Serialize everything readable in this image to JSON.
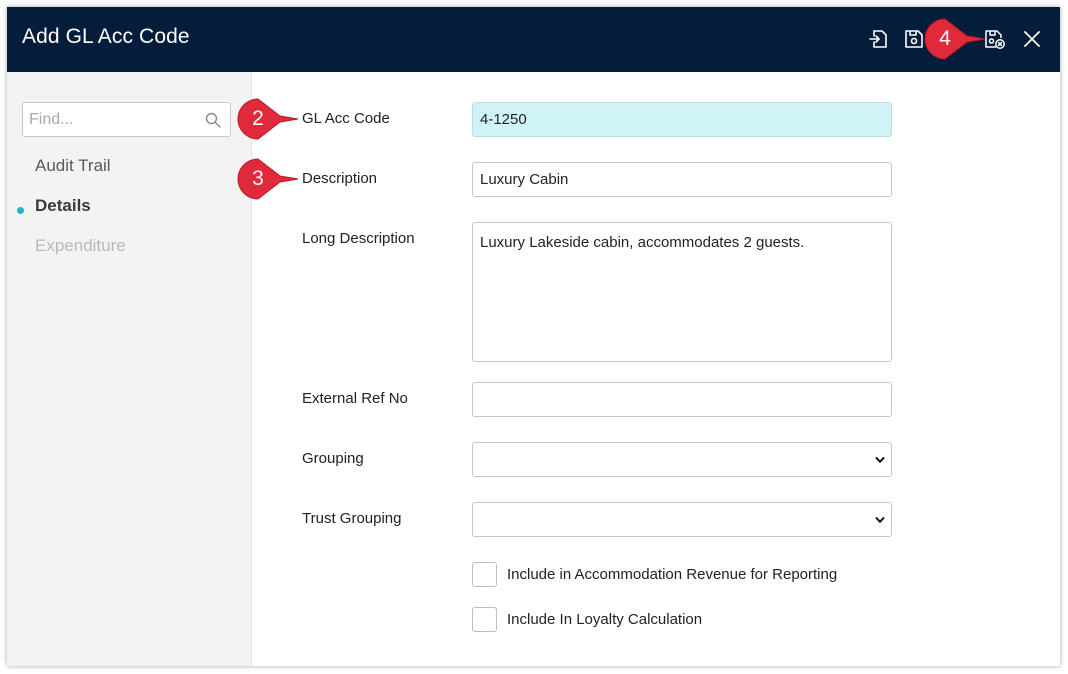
{
  "window": {
    "title": "Add GL Acc Code"
  },
  "toolbar": {
    "icons": [
      "save-exit-icon",
      "save-icon",
      "save-cancel-icon",
      "close-icon"
    ]
  },
  "sidebar": {
    "search_placeholder": "Find...",
    "items": [
      {
        "label": "Audit Trail",
        "state": "normal"
      },
      {
        "label": "Details",
        "state": "active"
      },
      {
        "label": "Expenditure",
        "state": "disabled"
      }
    ]
  },
  "form": {
    "gl_acc_code": {
      "label": "GL Acc Code",
      "value": "4-1250"
    },
    "description": {
      "label": "Description",
      "value": "Luxury Cabin"
    },
    "long_description": {
      "label": "Long Description",
      "value": "Luxury Lakeside cabin, accommodates 2 guests."
    },
    "external_ref": {
      "label": "External Ref No",
      "value": ""
    },
    "grouping": {
      "label": "Grouping",
      "value": ""
    },
    "trust_grouping": {
      "label": "Trust Grouping",
      "value": ""
    },
    "include_accommodation": {
      "label": "Include in Accommodation Revenue for Reporting",
      "checked": false
    },
    "include_loyalty": {
      "label": "Include In Loyalty Calculation",
      "checked": false
    }
  },
  "callouts": [
    "2",
    "3",
    "4"
  ],
  "colors": {
    "titlebar": "#041d3a",
    "accent": "#1bb6c9",
    "highlight_field": "#d0f3f8",
    "callout": "#e02a3b"
  }
}
